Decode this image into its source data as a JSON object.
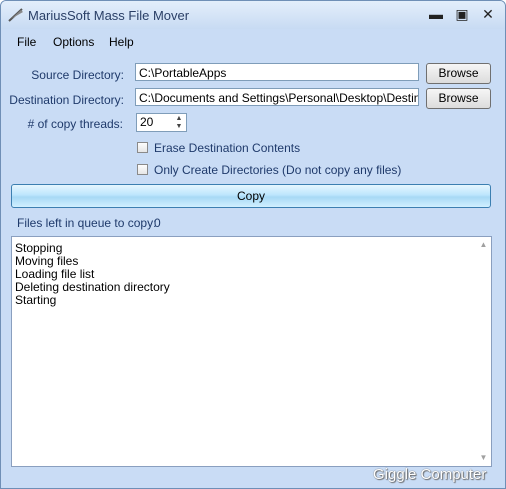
{
  "window": {
    "title": "MariusSoft Mass File Mover"
  },
  "titlebar_controls": {
    "minimize": "▬",
    "maximize": "▣",
    "close": "✕"
  },
  "menu": [
    "File",
    "Options",
    "Help"
  ],
  "form": {
    "source_label": "Source Directory:",
    "source_value": "C:\\PortableApps",
    "dest_label": "Destination Directory:",
    "dest_value": "C:\\Documents and Settings\\Personal\\Desktop\\Destinatio",
    "browse_label": "Browse",
    "threads_label": "# of copy threads:",
    "threads_value": "20",
    "erase_label": "Erase Destination Contents",
    "erase_checked": false,
    "only_dirs_label": "Only Create Directories (Do not copy any files)",
    "only_dirs_checked": false
  },
  "copy_button": "Copy",
  "queue": {
    "label": "Files left in queue to copy:",
    "value": "0"
  },
  "log": [
    "Stopping",
    "Moving files",
    "Loading file list",
    "Deleting destination directory",
    "Starting"
  ],
  "watermark": "Giggle Computer",
  "colors": {
    "window_bg": "#c9dcf5",
    "label_text": "#1f3a6b",
    "copy_button": "#bde6fd"
  },
  "icons": {
    "app": "feather-icon",
    "spin_up": "▲",
    "spin_down": "▼",
    "scroll_up": "▲",
    "scroll_down": "▼"
  }
}
